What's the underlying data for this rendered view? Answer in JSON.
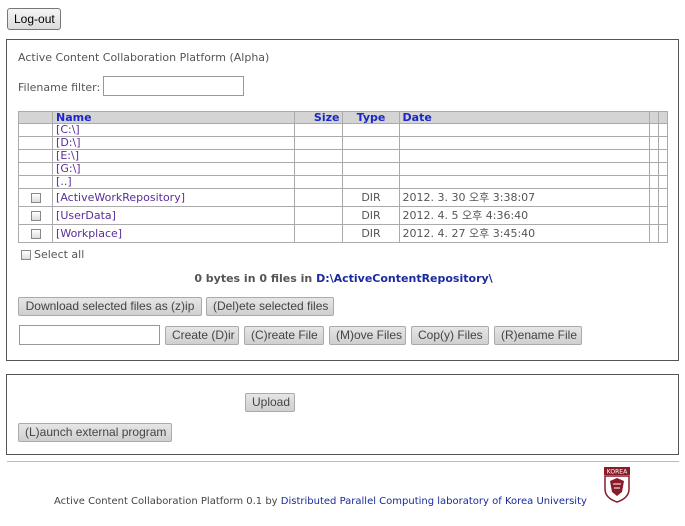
{
  "header": {
    "logout_label": "Log-out"
  },
  "main": {
    "title": "Active Content Collaboration Platform (Alpha)",
    "filter_label": "Filename filter:",
    "filter_value": "",
    "table": {
      "headers": {
        "name": "Name",
        "size": "Size",
        "type": "Type",
        "date": "Date"
      },
      "drives": [
        "[C:\\]",
        "[D:\\]",
        "[E:\\]",
        "[G:\\]",
        "[..]"
      ],
      "entries": [
        {
          "name": "[ActiveWorkRepository]",
          "type": "DIR",
          "date": "2012. 3. 30 오후 3:38:07"
        },
        {
          "name": "[UserData]",
          "type": "DIR",
          "date": "2012. 4. 5 오후 4:36:40"
        },
        {
          "name": "[Workplace]",
          "type": "DIR",
          "date": "2012. 4. 27 오후 3:45:40"
        }
      ]
    },
    "select_all_label": "Select all",
    "summary_text": "0 bytes in 0 files in",
    "summary_path": "D:\\ActiveContentRepository\\",
    "buttons": {
      "download_zip": "Download selected files as (z)ip",
      "delete": "(Del)ete selected files",
      "create_dir": "Create (D)ir",
      "create_file": "(C)reate File",
      "move_files": "(M)ove Files",
      "copy_files": "Cop(y) Files",
      "rename_file": "(R)ename File"
    },
    "command_input_value": ""
  },
  "upload_panel": {
    "upload_label": "Upload",
    "launch_label": "(L)aunch external program"
  },
  "footer": {
    "text": "Active Content Collaboration Platform 0.1 by",
    "lab_link": "Distributed Parallel Computing laboratory of Korea University",
    "logo_text": "KOREA"
  }
}
